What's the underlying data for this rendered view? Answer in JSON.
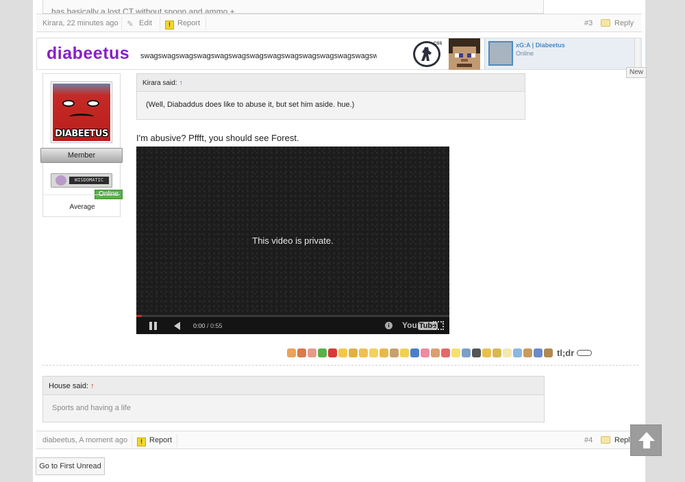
{
  "prev_post": {
    "text": "has basically a lost CT without spoon and ammo +",
    "author_time": "Kirara, 22 minutes ago",
    "edit_label": "Edit",
    "report_label": "Report",
    "post_number": "#3",
    "reply_label": "Reply"
  },
  "banner": {
    "username": "diabeetus",
    "swag_text": "swagswagswagswagswagswagswagswagswagswagswagswagswagswagswa...",
    "css_logo_label": "CSS",
    "steam_name": "xG:A | Diabeetus",
    "steam_status": "Online",
    "new_label": "New"
  },
  "user_card": {
    "avatar_text": "DIABEETUS",
    "rank": "Member",
    "badge_text": "WISDOMATIC",
    "online_label": "Online",
    "rating_label": "Average"
  },
  "post": {
    "quote_author": "Kirara said:",
    "quote_arrow": "↑",
    "quote_text": "(Well, Diabaddus does like to abuse it, but set him aside. hue.)",
    "text": "I'm abusive? Pffft, you should see Forest.",
    "video": {
      "message": "This video is private.",
      "time_current": "0:00",
      "time_total": " / 0:55",
      "logo_you": "You",
      "logo_tube": "Tube",
      "info_glyph": "i",
      "progress": 0.0
    },
    "ratings_tldr": "tl;dr",
    "rating_icons": [
      {
        "name": "like-icon",
        "color": "#e8a45c"
      },
      {
        "name": "dislike-icon",
        "color": "#d87a4e"
      },
      {
        "name": "agree-icon",
        "color": "#e89a8a"
      },
      {
        "name": "check-icon",
        "color": "#58b048"
      },
      {
        "name": "disagree-icon",
        "color": "#d83a3a"
      },
      {
        "name": "funny-icon",
        "color": "#f2c84a"
      },
      {
        "name": "winner-icon",
        "color": "#e0b040"
      },
      {
        "name": "informative-icon",
        "color": "#f0c050"
      },
      {
        "name": "useful-icon",
        "color": "#f2d060"
      },
      {
        "name": "friendly-icon",
        "color": "#e8b848"
      },
      {
        "name": "optimistic-icon",
        "color": "#c8a070"
      },
      {
        "name": "creative-icon",
        "color": "#f0d050"
      },
      {
        "name": "artistic-icon",
        "color": "#4a7fc8"
      },
      {
        "name": "love-icon",
        "color": "#f08aa0"
      },
      {
        "name": "zing-icon",
        "color": "#d8a070"
      },
      {
        "name": "rainbow-icon",
        "color": "#e06a6a"
      },
      {
        "name": "idea-icon",
        "color": "#f6e070"
      },
      {
        "name": "late-icon",
        "color": "#7a9fc8"
      },
      {
        "name": "dumb-icon",
        "color": "#555555"
      },
      {
        "name": "coffee-icon",
        "color": "#e8c050"
      },
      {
        "name": "mad-icon",
        "color": "#d8b850"
      },
      {
        "name": "paper-icon",
        "color": "#f2e8b0"
      },
      {
        "name": "diamond-icon",
        "color": "#8ab8e0"
      },
      {
        "name": "box-icon",
        "color": "#c89a60"
      },
      {
        "name": "sleep-icon",
        "color": "#6a8ac8"
      },
      {
        "name": "poop-icon",
        "color": "#b08a50"
      }
    ]
  },
  "signature": {
    "author": "House said:",
    "arrow": "↑",
    "text": "Sports and having a life"
  },
  "post_footer": {
    "author_time": "diabeetus, A moment ago",
    "report_label": "Report",
    "post_number": "#4",
    "reply_label": "Reply"
  },
  "go_first_unread": "Go to First Unread"
}
